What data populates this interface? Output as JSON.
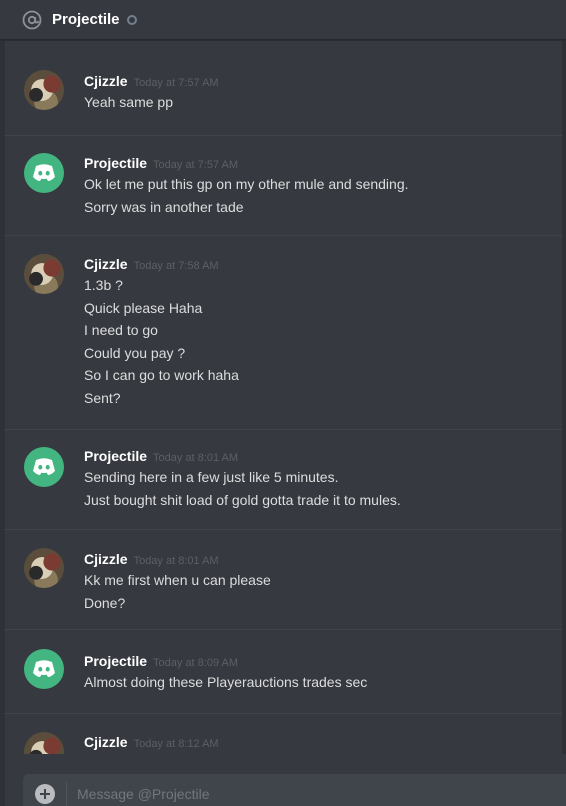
{
  "header": {
    "title": "Projectile",
    "icon": "at-icon",
    "status": "offline"
  },
  "messages": [
    {
      "author": "Cjizzle",
      "avatar": "user-photo",
      "timestamp": "Today at 7:57 AM",
      "lines": [
        "Yeah same pp"
      ]
    },
    {
      "author": "Projectile",
      "avatar": "discord-logo",
      "timestamp": "Today at 7:57 AM",
      "lines": [
        "Ok let me put this gp on my other mule and sending.",
        "Sorry was in another tade"
      ]
    },
    {
      "author": "Cjizzle",
      "avatar": "user-photo",
      "timestamp": "Today at 7:58 AM",
      "lines": [
        "1.3b ?",
        "Quick please Haha",
        "I need to go",
        "Could you pay ?",
        "So I can go to work haha",
        "Sent?"
      ]
    },
    {
      "author": "Projectile",
      "avatar": "discord-logo",
      "timestamp": "Today at 8:01 AM",
      "lines": [
        "Sending here in a few just like 5 minutes.",
        "Just bought shit load of gold gotta trade it to mules."
      ]
    },
    {
      "author": "Cjizzle",
      "avatar": "user-photo",
      "timestamp": "Today at 8:01 AM",
      "lines": [
        "Kk me first when u can please",
        "Done?"
      ]
    },
    {
      "author": "Projectile",
      "avatar": "discord-logo",
      "timestamp": "Today at 8:09 AM",
      "lines": [
        "Almost doing these Playerauctions trades sec"
      ]
    },
    {
      "author": "Cjizzle",
      "avatar": "user-photo",
      "timestamp": "Today at 8:12 AM",
      "lines": []
    }
  ],
  "composer": {
    "placeholder": "Message @Projectile",
    "value": ""
  },
  "colors": {
    "background": "#36393f",
    "discord_green": "#43b581",
    "timestamp": "#5c5f64",
    "divider": "#40444b"
  }
}
